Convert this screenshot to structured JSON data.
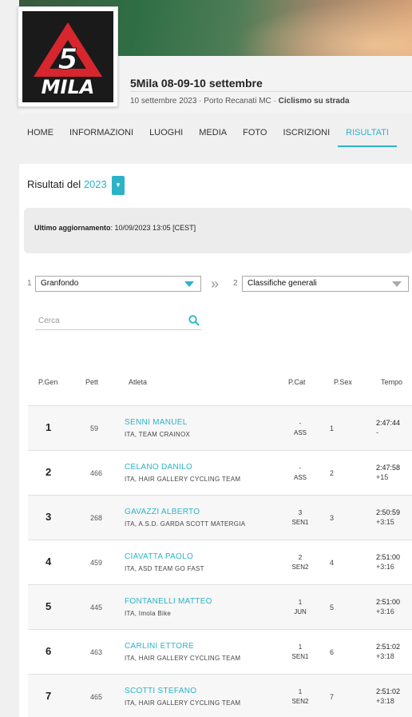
{
  "event": {
    "title": "5Mila 08-09-10 settembre",
    "subtitle_prefix": "10 settembre 2023 · Porto Recanati MC · ",
    "subtitle_bold": "Ciclismo su strada",
    "logo_text": "5 MILA"
  },
  "nav": {
    "items": [
      "HOME",
      "INFORMAZIONI",
      "LUOGHI",
      "MEDIA",
      "FOTO",
      "ISCRIZIONI",
      "RISULTATI"
    ],
    "active": "RISULTATI"
  },
  "results": {
    "title_prefix": "Risultati del ",
    "year": "2023",
    "update_label": "Ultimo aggiornamento",
    "update_value": ": 10/09/2023 13:05 [CEST]"
  },
  "filters": {
    "step1_num": "1",
    "step1_value": "Granfondo",
    "step2_num": "2",
    "step2_value": "Classifiche generali",
    "search_placeholder": "Cerca"
  },
  "table": {
    "headers": [
      "P.Gen",
      "Pett",
      "Atleta",
      "P.Cat",
      "P.Sex",
      "Tempo"
    ],
    "rows": [
      {
        "pos": "1",
        "bib": "59",
        "name": "SENNI MANUEL",
        "team": "ITA, TEAM CRAINOX",
        "cat1": "-",
        "cat2": "ASS",
        "sex": "1",
        "time": "2:47:44",
        "gap": "-"
      },
      {
        "pos": "2",
        "bib": "466",
        "name": "CELANO DANILO",
        "team": "ITA, HAIR GALLERY CYCLING TEAM",
        "cat1": "-",
        "cat2": "ASS",
        "sex": "2",
        "time": "2:47:58",
        "gap": "+15"
      },
      {
        "pos": "3",
        "bib": "268",
        "name": "GAVAZZI ALBERTO",
        "team": "ITA, A.S.D. GARDA SCOTT MATERGIA",
        "cat1": "3",
        "cat2": "SEN1",
        "sex": "3",
        "time": "2:50:59",
        "gap": "+3:15"
      },
      {
        "pos": "4",
        "bib": "459",
        "name": "CIAVATTA PAOLO",
        "team": "ITA, ASD TEAM GO FAST",
        "cat1": "2",
        "cat2": "SEN2",
        "sex": "4",
        "time": "2:51:00",
        "gap": "+3:16"
      },
      {
        "pos": "5",
        "bib": "445",
        "name": "FONTANELLI MATTEO",
        "team": "ITA, Imola Bike",
        "cat1": "1",
        "cat2": "JUN",
        "sex": "5",
        "time": "2:51:00",
        "gap": "+3:16"
      },
      {
        "pos": "6",
        "bib": "463",
        "name": "CARLINI ETTORE",
        "team": "ITA, HAIR GALLERY CYCLING TEAM",
        "cat1": "1",
        "cat2": "SEN1",
        "sex": "6",
        "time": "2:51:02",
        "gap": "+3:18"
      },
      {
        "pos": "7",
        "bib": "465",
        "name": "SCOTTI STEFANO",
        "team": "ITA, HAIR GALLERY CYCLING TEAM",
        "cat1": "1",
        "cat2": "SEN2",
        "sex": "7",
        "time": "2:51:02",
        "gap": "+3:18"
      }
    ]
  },
  "colors": {
    "accent": "#2bb3c8",
    "logo_red": "#d7262e",
    "logo_bg": "#1a1a1a"
  }
}
